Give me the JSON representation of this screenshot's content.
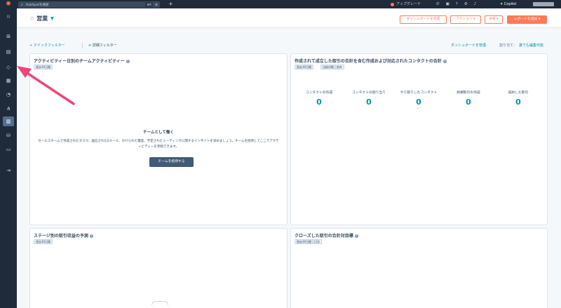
{
  "topbar": {
    "search_placeholder": "HubSpotを検索",
    "search_shortcut": "⌘K",
    "search_shortcut_extra": "⌘",
    "add": "+",
    "upgrade": "アップグレード",
    "copilot": "Copilot"
  },
  "header": {
    "title": "営業",
    "btn_create_dashboard": "ダッシュボードを作成",
    "btn_actions": "アクション ▾",
    "btn_share": "共有 ▾",
    "btn_add_report": "レポートを追加 ▾"
  },
  "filters": {
    "quick_filter": "+ クイックフィルター",
    "advanced_filter": "詳細フィルター",
    "manage_dashboard": "ダッシュボードを管理",
    "assigned_label": "割り当て：",
    "assigned_value": "誰でも編集可能"
  },
  "cards": {
    "team_activity": {
      "title": "アクティビティー日別のチームアクティビティー",
      "tag": "過去30日間",
      "empty_title": "チームとして働く",
      "empty_body": "セールスチームで作成されたタスク、送信されたEメール、かけられた電話、予定されたミーティングに関するインサイトを深めましょう。チームを招待してここでアクティビティーを参照できます。",
      "empty_button": "チームを招待する"
    },
    "deal_contacts": {
      "title": "作成されて成立した取引の合計を含む作成および対応されたコンタクトの合計",
      "tag1": "過去30日間",
      "tag2": "比較対象 | 前年",
      "metrics": [
        {
          "label": "コンタクトの作成",
          "value": "0"
        },
        {
          "label": "コンタクトの割り当て",
          "value": "0"
        },
        {
          "label": "やり取りしたコンタクト",
          "value": "0"
        },
        {
          "label": "新規取引の作成",
          "value": "0"
        },
        {
          "label": "成約した取引",
          "value": "0"
        }
      ]
    },
    "stage_forecast": {
      "title": "ステージ別の取引収益の予測",
      "tag": "過去30日間"
    },
    "closed_vs_goal": {
      "title": "クローズした取引の合計対目標",
      "tag": "過去30日間 | 日次"
    }
  },
  "colors": {
    "accent": "#ff7a59",
    "link": "#0091ae",
    "annotation_arrow": "#f0447a"
  },
  "icons": {
    "logo": "hubspot-logo",
    "sidebar": [
      "bookmark",
      "grid",
      "contacts",
      "megaphone",
      "content",
      "commerce",
      "automation",
      "reports",
      "data",
      "library",
      "collapse"
    ]
  }
}
